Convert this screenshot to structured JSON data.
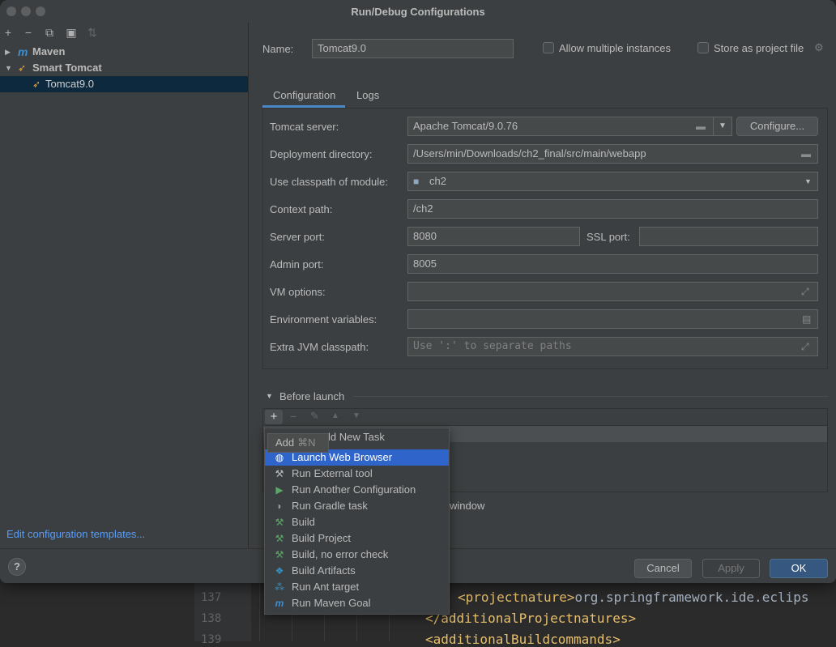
{
  "window": {
    "title": "Run/Debug Configurations"
  },
  "left_toolbar": {
    "add": "+",
    "remove": "−",
    "copy": "⧉",
    "folder": "▣",
    "sort": "⇅"
  },
  "tree": {
    "maven": "Maven",
    "smart_tomcat": "Smart Tomcat",
    "tomcat90": "Tomcat9.0"
  },
  "edit_templates": "Edit configuration templates...",
  "header": {
    "name_label": "Name:",
    "name_value": "Tomcat9.0",
    "allow_multiple": "Allow multiple instances",
    "store_project": "Store as project file"
  },
  "tabs": {
    "configuration": "Configuration",
    "logs": "Logs"
  },
  "config": {
    "tomcat_server_label": "Tomcat server:",
    "tomcat_server_value": "Apache Tomcat/9.0.76",
    "configure_btn": "Configure...",
    "deploy_dir_label": "Deployment directory:",
    "deploy_dir_value": "/Users/min/Downloads/ch2_final/src/main/webapp",
    "classpath_label": "Use classpath of module:",
    "classpath_value": "ch2",
    "context_label": "Context path:",
    "context_value": "/ch2",
    "server_port_label": "Server port:",
    "server_port_value": "8080",
    "ssl_port_label": "SSL port:",
    "ssl_port_value": "",
    "admin_port_label": "Admin port:",
    "admin_port_value": "8005",
    "vm_label": "VM options:",
    "vm_value": "",
    "env_label": "Environment variables:",
    "env_value": "",
    "jvm_cp_label": "Extra JVM classpath:",
    "jvm_cp_placeholder": "Use ':' to separate paths"
  },
  "before_launch": {
    "title": "Before launch",
    "window_partial": "window"
  },
  "popup": {
    "header": "Add New Task",
    "tooltip": "Add",
    "tooltip_shortcut": "⌘N",
    "items": [
      "Launch Web Browser",
      "Run External tool",
      "Run Another Configuration",
      "Run Gradle task",
      "Build",
      "Build Project",
      "Build, no error check",
      "Build Artifacts",
      "Run Ant target",
      "Run Maven Goal"
    ]
  },
  "buttons": {
    "help": "?",
    "cancel": "Cancel",
    "apply": "Apply",
    "ok": "OK"
  },
  "editor": {
    "line_137": "137",
    "line_138": "138",
    "line_139": "139",
    "code_137_open": "<projectnature>",
    "code_137_text": "org.springframework.ide.eclips",
    "code_138": "</additionalProjectnatures>",
    "code_139": "<additionalBuildcommands>"
  }
}
